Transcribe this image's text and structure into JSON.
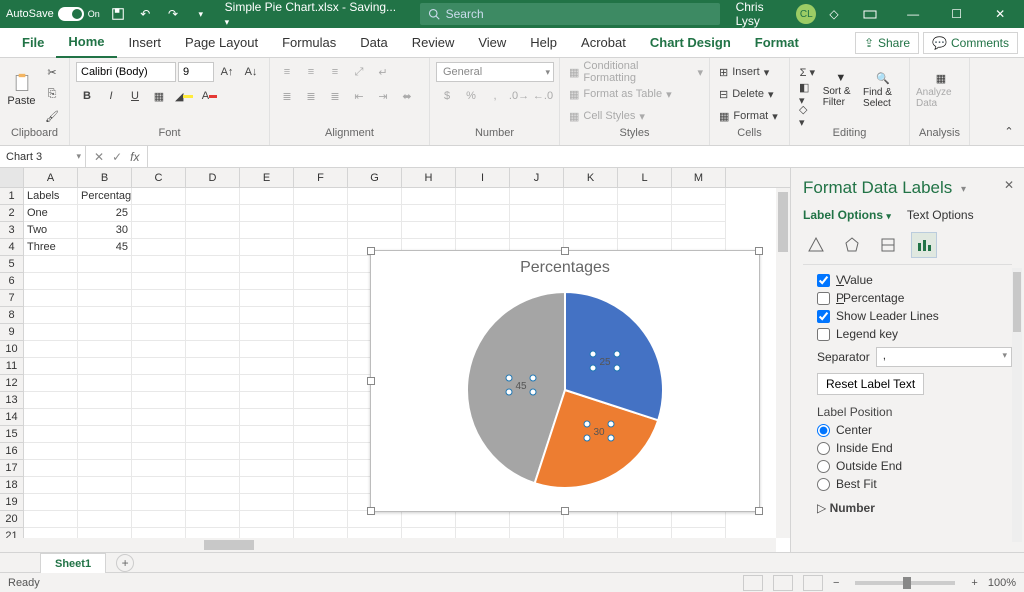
{
  "titlebar": {
    "autosave": "AutoSave",
    "autosave_state": "On",
    "filename": "Simple Pie Chart.xlsx - Saving...",
    "search_placeholder": "Search",
    "user_name": "Chris Lysy",
    "user_initials": "CL"
  },
  "tabs": [
    "File",
    "Home",
    "Insert",
    "Page Layout",
    "Formulas",
    "Data",
    "Review",
    "View",
    "Help",
    "Acrobat",
    "Chart Design",
    "Format"
  ],
  "active_tab": "Home",
  "context_tabs": [
    "Chart Design",
    "Format"
  ],
  "share": "Share",
  "comments": "Comments",
  "ribbon": {
    "clipboard": {
      "paste": "Paste",
      "label": "Clipboard"
    },
    "font": {
      "name": "Calibri (Body)",
      "size": "9",
      "label": "Font"
    },
    "alignment": {
      "label": "Alignment"
    },
    "number": {
      "format": "General",
      "label": "Number"
    },
    "styles": {
      "cond": "Conditional Formatting",
      "table": "Format as Table",
      "cell": "Cell Styles",
      "label": "Styles"
    },
    "cells": {
      "insert": "Insert",
      "delete": "Delete",
      "format": "Format",
      "label": "Cells"
    },
    "editing": {
      "sort": "Sort & Filter",
      "find": "Find & Select",
      "label": "Editing"
    },
    "analysis": {
      "analyze": "Analyze Data",
      "label": "Analysis"
    }
  },
  "namebox": "Chart 3",
  "columns": [
    "A",
    "B",
    "C",
    "D",
    "E",
    "F",
    "G",
    "H",
    "I",
    "J",
    "K",
    "L",
    "M"
  ],
  "grid_header": {
    "A": "Labels",
    "B": "Percentages"
  },
  "grid_rows": [
    {
      "A": "One",
      "B": "25"
    },
    {
      "A": "Two",
      "B": "30"
    },
    {
      "A": "Three",
      "B": "45"
    }
  ],
  "chart": {
    "title": "Percentages"
  },
  "chart_data": {
    "type": "pie",
    "title": "Percentages",
    "categories": [
      "One",
      "Two",
      "Three"
    ],
    "values": [
      25,
      30,
      45
    ],
    "colors": [
      "#4472c4",
      "#ed7d31",
      "#a5a5a5"
    ],
    "data_labels": "value",
    "label_position": "center",
    "show_leader_lines": true
  },
  "pane": {
    "title": "Format Data Labels",
    "label_options": "Label Options",
    "text_options": "Text Options",
    "value": "Value",
    "percentage": "Percentage",
    "leader": "Show Leader Lines",
    "legend_key": "Legend key",
    "separator": "Separator",
    "separator_value": ",",
    "reset": "Reset Label Text",
    "label_position": "Label Position",
    "pos_center": "Center",
    "pos_inside": "Inside End",
    "pos_outside": "Outside End",
    "pos_best": "Best Fit",
    "number": "Number"
  },
  "sheet_tab": "Sheet1",
  "status": "Ready",
  "zoom": "100%"
}
